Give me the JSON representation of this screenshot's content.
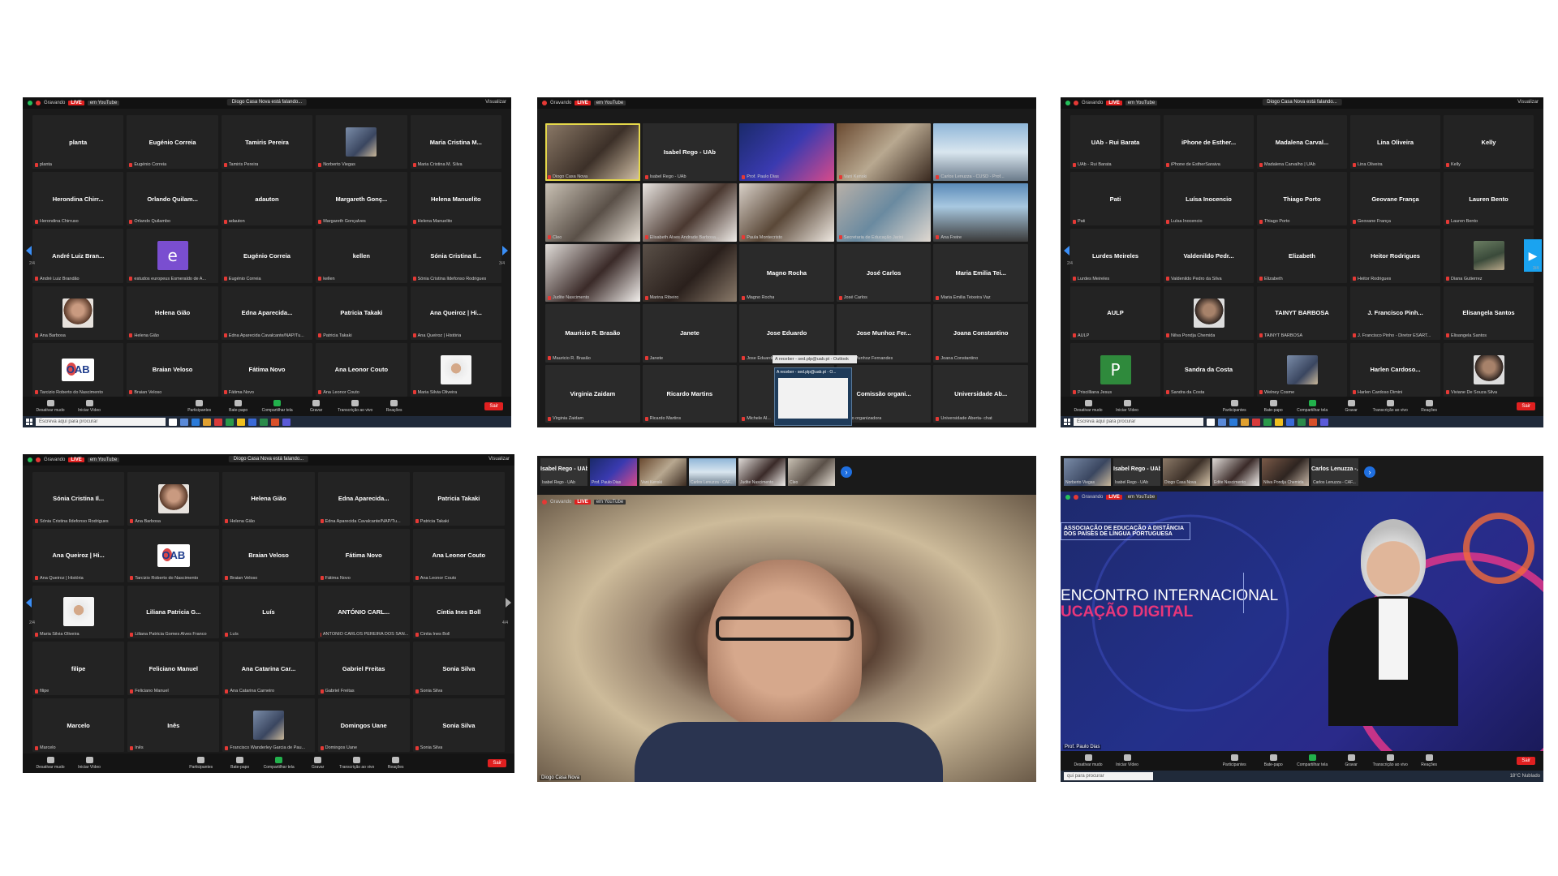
{
  "common": {
    "recording_label": "Gravando",
    "live_label": "LIVE",
    "youtube_label": "em YouTube",
    "view_label": "Visualizar",
    "speaking_label": "Diogo Casa Nova está falando...",
    "search_placeholder": "Escreva aqui para procurar",
    "leave_label": "Sair",
    "toolbar": [
      "Desativar mudo",
      "Iniciar Vídeo",
      "Participantes",
      "Bate-papo",
      "Compartilhar tela",
      "Gravar",
      "Transcrição ao vivo",
      "Reações"
    ],
    "participants_count": "89"
  },
  "panel1": {
    "page_left": "2/4",
    "page_right": "3/4",
    "tiles": [
      {
        "name": "planta",
        "cap": "planta"
      },
      {
        "name": "Eugénio Correia",
        "cap": "Eugénio Correia"
      },
      {
        "name": "Tamiris Pereira",
        "cap": "Tamiris Pereira"
      },
      {
        "name": "",
        "cap": "Norberto Viegas",
        "img": "ph1"
      },
      {
        "name": "Maria Cristina M...",
        "cap": "Maria Cristina M. Silva"
      },
      {
        "name": "Herondina Chirr...",
        "cap": "Herondina Chirruso"
      },
      {
        "name": "Orlando Quilam...",
        "cap": "Orlando Quilambo"
      },
      {
        "name": "adauton",
        "cap": "adauton"
      },
      {
        "name": "Margareth Gonç...",
        "cap": "Margareth Gonçalves"
      },
      {
        "name": "Helena Manuelito",
        "cap": "Helena Manuelito"
      },
      {
        "name": "André Luiz Bran...",
        "cap": "André Luiz Brandão"
      },
      {
        "name": "",
        "cap": "estudos europeus Esmeraldo de A...",
        "letter": "e",
        "lc": "av-purple"
      },
      {
        "name": "Eugénio Correia",
        "cap": "Eugénio Correia"
      },
      {
        "name": "kellen",
        "cap": "kellen"
      },
      {
        "name": "Sónia Cristina Il...",
        "cap": "Sónia Cristina Ildefonso Rodrigues"
      },
      {
        "name": "",
        "cap": "Ana Barbosa",
        "img": "ph2"
      },
      {
        "name": "Helena Gião",
        "cap": "Helena Gião"
      },
      {
        "name": "Edna Aparecida...",
        "cap": "Edna Aparecida Cavalcante/NAP/Tu..."
      },
      {
        "name": "Patricia Takaki",
        "cap": "Patricia Takaki"
      },
      {
        "name": "Ana Queiroz | Hi...",
        "cap": "Ana Queiroz | História"
      },
      {
        "name": "",
        "cap": "Tarcizio Roberto do Nascimento",
        "logo": "OAB"
      },
      {
        "name": "Braian Veloso",
        "cap": "Braian Veloso"
      },
      {
        "name": "Fátima Novo",
        "cap": "Fátima Novo"
      },
      {
        "name": "Ana Leonor Couto",
        "cap": "Ana Leonor Couto"
      },
      {
        "name": "",
        "cap": "Maria Silvia Oliveira",
        "img": "ph4"
      }
    ]
  },
  "panel2": {
    "videos": [
      {
        "cap": "Diogo Casa Nova",
        "bg": "linear-gradient(135deg,#8c7a68,#3c3028 55%,#d6c4aa)"
      },
      {
        "cap": "Isabel Rego - UAb",
        "name": "Isabel Rego - UAb",
        "bg": "#2a2a2a"
      },
      {
        "cap": "Prof. Paulo Dias",
        "bg": "linear-gradient(135deg,#1a2a6a,#3a3ab0 50%,#d84a8a)"
      },
      {
        "cap": "Vani Kenski",
        "bg": "linear-gradient(135deg,#6a4a30,#b8a890 50%,#3a2a20)"
      },
      {
        "cap": "Carlos Lenuzza - CUSD - Prof...",
        "bg": "linear-gradient(180deg,#8fb6d8,#d9e6ef 50%,#6a7a8a)"
      },
      {
        "cap": "Cleo",
        "bg": "linear-gradient(135deg,#c9c1b4,#5a5048 55%,#e6dfd5)"
      },
      {
        "cap": "Elisabeth Alves Andrade Barbosa...",
        "bg": "linear-gradient(135deg,#e8e4e0,#4a3830 55%,#f0ece8)"
      },
      {
        "cap": "Paula Montecristo",
        "bg": "linear-gradient(135deg,#d8d0c8,#5a4838 50%,#efe9e2)"
      },
      {
        "cap": "Secretaria de Educação Jarini",
        "bg": "linear-gradient(135deg,#b8b0a8,#6a8aa0 50%,#e0d8d0)"
      },
      {
        "cap": "Ana Freire",
        "bg": "linear-gradient(180deg,#5a8ab8,#a8c8e0 40%,#3a3a3a)"
      },
      {
        "cap": "Judite Nascimento",
        "bg": "linear-gradient(135deg,#e0dcd8,#3a2a28 55%,#f2efec)"
      },
      {
        "cap": "Marina Ribeiro",
        "bg": "linear-gradient(135deg,#5a5048,#2a201c 55%,#8a7a6a)"
      },
      {
        "cap": "Magno Rocha",
        "name": "Magno Rocha",
        "bg": "#2a2a2a"
      },
      {
        "cap": "José Carlos",
        "name": "José Carlos",
        "bg": "#2a2a2a"
      },
      {
        "cap": "Maria Emilia Teixeira Vaz",
        "name": "Maria Emilia Tei...",
        "bg": "#2a2a2a"
      },
      {
        "cap": "Mauricio R. Brasão",
        "name": "Mauricio R. Brasão",
        "bg": "#2a2a2a"
      },
      {
        "cap": "Janete",
        "name": "Janete",
        "bg": "#2a2a2a"
      },
      {
        "cap": "Jose Eduardo",
        "name": "Jose Eduardo",
        "bg": "#2a2a2a"
      },
      {
        "cap": "Jose Munhoz Fernandes",
        "name": "Jose Munhoz Fer...",
        "bg": "#2a2a2a"
      },
      {
        "cap": "Joana Constantino",
        "name": "Joana Constantino",
        "bg": "#2a2a2a"
      },
      {
        "cap": "Virginia Zaidam",
        "name": "Virginia Zaidam",
        "bg": "#2a2a2a"
      },
      {
        "cap": "Ricardo Martins",
        "name": "Ricardo Martins",
        "bg": "#2a2a2a"
      },
      {
        "cap": "Michele Al...",
        "name": "",
        "bg": "#2a2a2a"
      },
      {
        "cap": "issão organizadora",
        "name": "Comissão organi...",
        "bg": "#2a2a2a"
      },
      {
        "cap": "Universidade Aberta- chat",
        "name": "Universidade Ab...",
        "bg": "#2a2a2a"
      }
    ],
    "tooltip": "A receber - sed.plp@uab.pt - Outlook",
    "tooltip2": "A receber - sed.plp@uab.pt - O..."
  },
  "panel3": {
    "page_left": "2/4",
    "page_right": "3/4",
    "tiles": [
      {
        "name": "UAb - Rui Barata",
        "cap": "UAb - Rui Barata"
      },
      {
        "name": "iPhone de Esther...",
        "cap": "iPhone de EstherSaraiva"
      },
      {
        "name": "Madalena Carval...",
        "cap": "Madalena Carvalho | UAb"
      },
      {
        "name": "Lina Oliveira",
        "cap": "Lina Oliveira"
      },
      {
        "name": "Kelly",
        "cap": "Kelly"
      },
      {
        "name": "Pati",
        "cap": "Pati"
      },
      {
        "name": "Luísa Inocencio",
        "cap": "Luísa Inocencio"
      },
      {
        "name": "Thiago Porto",
        "cap": "Thiago Porto"
      },
      {
        "name": "Geovane França",
        "cap": "Geovane França"
      },
      {
        "name": "Lauren Bento",
        "cap": "Lauren Bento"
      },
      {
        "name": "Lurdes Meireles",
        "cap": "Lurdes Meireles"
      },
      {
        "name": "Valdenildo Pedr...",
        "cap": "Valdenildo Pedro da Silva"
      },
      {
        "name": "Elizabeth",
        "cap": "Elizabeth"
      },
      {
        "name": "Heitor Rodrigues",
        "cap": "Heitor Rodrigues"
      },
      {
        "name": "",
        "cap": "Diana Gutierrez",
        "img": "ph5"
      },
      {
        "name": "AULP",
        "cap": "AULP"
      },
      {
        "name": "",
        "cap": "Nilva Pondja Chemida",
        "img": "ph3"
      },
      {
        "name": "TAINYT BARBOSA",
        "cap": "TAINYT BARBOSA"
      },
      {
        "name": "J. Francisco Pinh...",
        "cap": "J. Francisco Pinho - Diretor ESART..."
      },
      {
        "name": "Elisangela Santos",
        "cap": "Elisangela Santos"
      },
      {
        "name": "",
        "cap": "Priscilliana Jesus",
        "letter": "P",
        "lc": "av-green"
      },
      {
        "name": "Sandra da Costa",
        "cap": "Sandra da Costa"
      },
      {
        "name": "",
        "cap": "Welney Cosme",
        "img": "ph1"
      },
      {
        "name": "Harlen Cardoso...",
        "cap": "Harlen Cardoso Dimini"
      },
      {
        "name": "",
        "cap": "Viviane De Souza Silva",
        "img": "ph3"
      }
    ]
  },
  "panel4": {
    "page_left": "2/4",
    "page_right": "4/4",
    "tiles": [
      {
        "name": "Sónia Cristina Il...",
        "cap": "Sónia Cristina Ildefonso Rodrigues"
      },
      {
        "name": "",
        "cap": "Ana Barbosa",
        "img": "ph2"
      },
      {
        "name": "Helena Gião",
        "cap": "Helena Gião"
      },
      {
        "name": "Edna Aparecida...",
        "cap": "Edna Aparecida Cavalcante/NAP/Tu..."
      },
      {
        "name": "Patricia Takaki",
        "cap": "Patricia Takaki"
      },
      {
        "name": "Ana Queiroz | Hi...",
        "cap": "Ana Queiroz | História"
      },
      {
        "name": "",
        "cap": "Tarcizio Roberto do Nascimento",
        "logo": "OAB"
      },
      {
        "name": "Braian Veloso",
        "cap": "Braian Veloso"
      },
      {
        "name": "Fátima Novo",
        "cap": "Fátima Novo"
      },
      {
        "name": "Ana Leonor Couto",
        "cap": "Ana Leonor Couto"
      },
      {
        "name": "",
        "cap": "Maria Silvia Oliveira",
        "img": "ph4"
      },
      {
        "name": "Liliana Patricia G...",
        "cap": "Liliana Patricia Gomes Alves Franco"
      },
      {
        "name": "Luís",
        "cap": "Luís"
      },
      {
        "name": "ANTÓNIO CARL...",
        "cap": "ANTÓNIO CARLOS PEREIRA DOS SAN..."
      },
      {
        "name": "Cintia Ines Boll",
        "cap": "Cintia Ines Boll"
      },
      {
        "name": "filipe",
        "cap": "filipe"
      },
      {
        "name": "Feliciano Manuel",
        "cap": "Feliciano Manuel"
      },
      {
        "name": "Ana Catarina Car...",
        "cap": "Ana Catarina Carneiro"
      },
      {
        "name": "Gabriel Freitas",
        "cap": "Gabriel Freitas"
      },
      {
        "name": "Sonia Silva",
        "cap": "Sonia Silva"
      },
      {
        "name": "Marcelo",
        "cap": "Marcelo"
      },
      {
        "name": "Inês",
        "cap": "Inês"
      },
      {
        "name": "",
        "cap": "Francisco Wanderley Garcia de Pau...",
        "img": "ph1"
      },
      {
        "name": "Domingos Uane",
        "cap": "Domingos Uane"
      },
      {
        "name": "Sonia Silva",
        "cap": "Sonia Silva"
      }
    ]
  },
  "panel5": {
    "strip": [
      {
        "name": "Isabel Rego - UAb",
        "cap": "Isabel Rego - UAb",
        "bg": "#333"
      },
      {
        "name": "",
        "cap": "Prof. Paulo Dias",
        "bg": "linear-gradient(135deg,#1a2a6a,#3a3ab0 50%,#d84a8a)"
      },
      {
        "name": "",
        "cap": "Vani Kenski",
        "bg": "linear-gradient(135deg,#6a4a30,#b8a890 50%,#3a2a20)"
      },
      {
        "name": "",
        "cap": "Carlos Lenuzza - CAF...",
        "bg": "linear-gradient(180deg,#8fb6d8,#d9e6ef 50%,#6a7a8a)"
      },
      {
        "name": "",
        "cap": "Judite Nascimento",
        "bg": "linear-gradient(135deg,#e0dcd8,#3a2a28 55%,#f2efec)"
      },
      {
        "name": "",
        "cap": "Cleo",
        "bg": "linear-gradient(135deg,#c9c1b4,#5a5048 55%,#e6dfd5)"
      }
    ],
    "main_caption": "Diogo Casa Nova"
  },
  "panel6": {
    "strip": [
      {
        "name": "",
        "cap": "Norberto Viegas",
        "bg": "linear-gradient(135deg,#7a8ca8,#3a4660 60%,#c9b79a)"
      },
      {
        "name": "Isabel Rego - UAb",
        "cap": "Isabel Rego - UAb",
        "bg": "#333"
      },
      {
        "name": "",
        "cap": "Diogo Casa Nova",
        "bg": "linear-gradient(135deg,#8c7a68,#3c3028 55%,#d6c4aa)"
      },
      {
        "name": "",
        "cap": "Edite Nascimento",
        "bg": "linear-gradient(135deg,#e0dcd8,#3a2a28 55%,#f2efec)"
      },
      {
        "name": "",
        "cap": "Nilva Pondja Chemida",
        "bg": "linear-gradient(135deg,#7a5a48,#2e2420 55%,#c8b8a8)"
      },
      {
        "name": "Carlos Lenuzza -...",
        "cap": "Carlos Lenuzza - CAF...",
        "bg": "#333"
      }
    ],
    "slide_org": "ASSOCIAÇÃO DE EDUCAÇÃO A DISTÂNCIA\nDOS PAÍSES DE LÍNGUA PORTUGUESA",
    "slide_title1": "ENCONTRO INTERNACIONAL",
    "slide_title2": "UCAÇÃO DIGITAL",
    "main_caption": "Prof. Paulo Dias",
    "weather": "18°C Nublado",
    "search_placeholder_short": "qui para procurar"
  }
}
